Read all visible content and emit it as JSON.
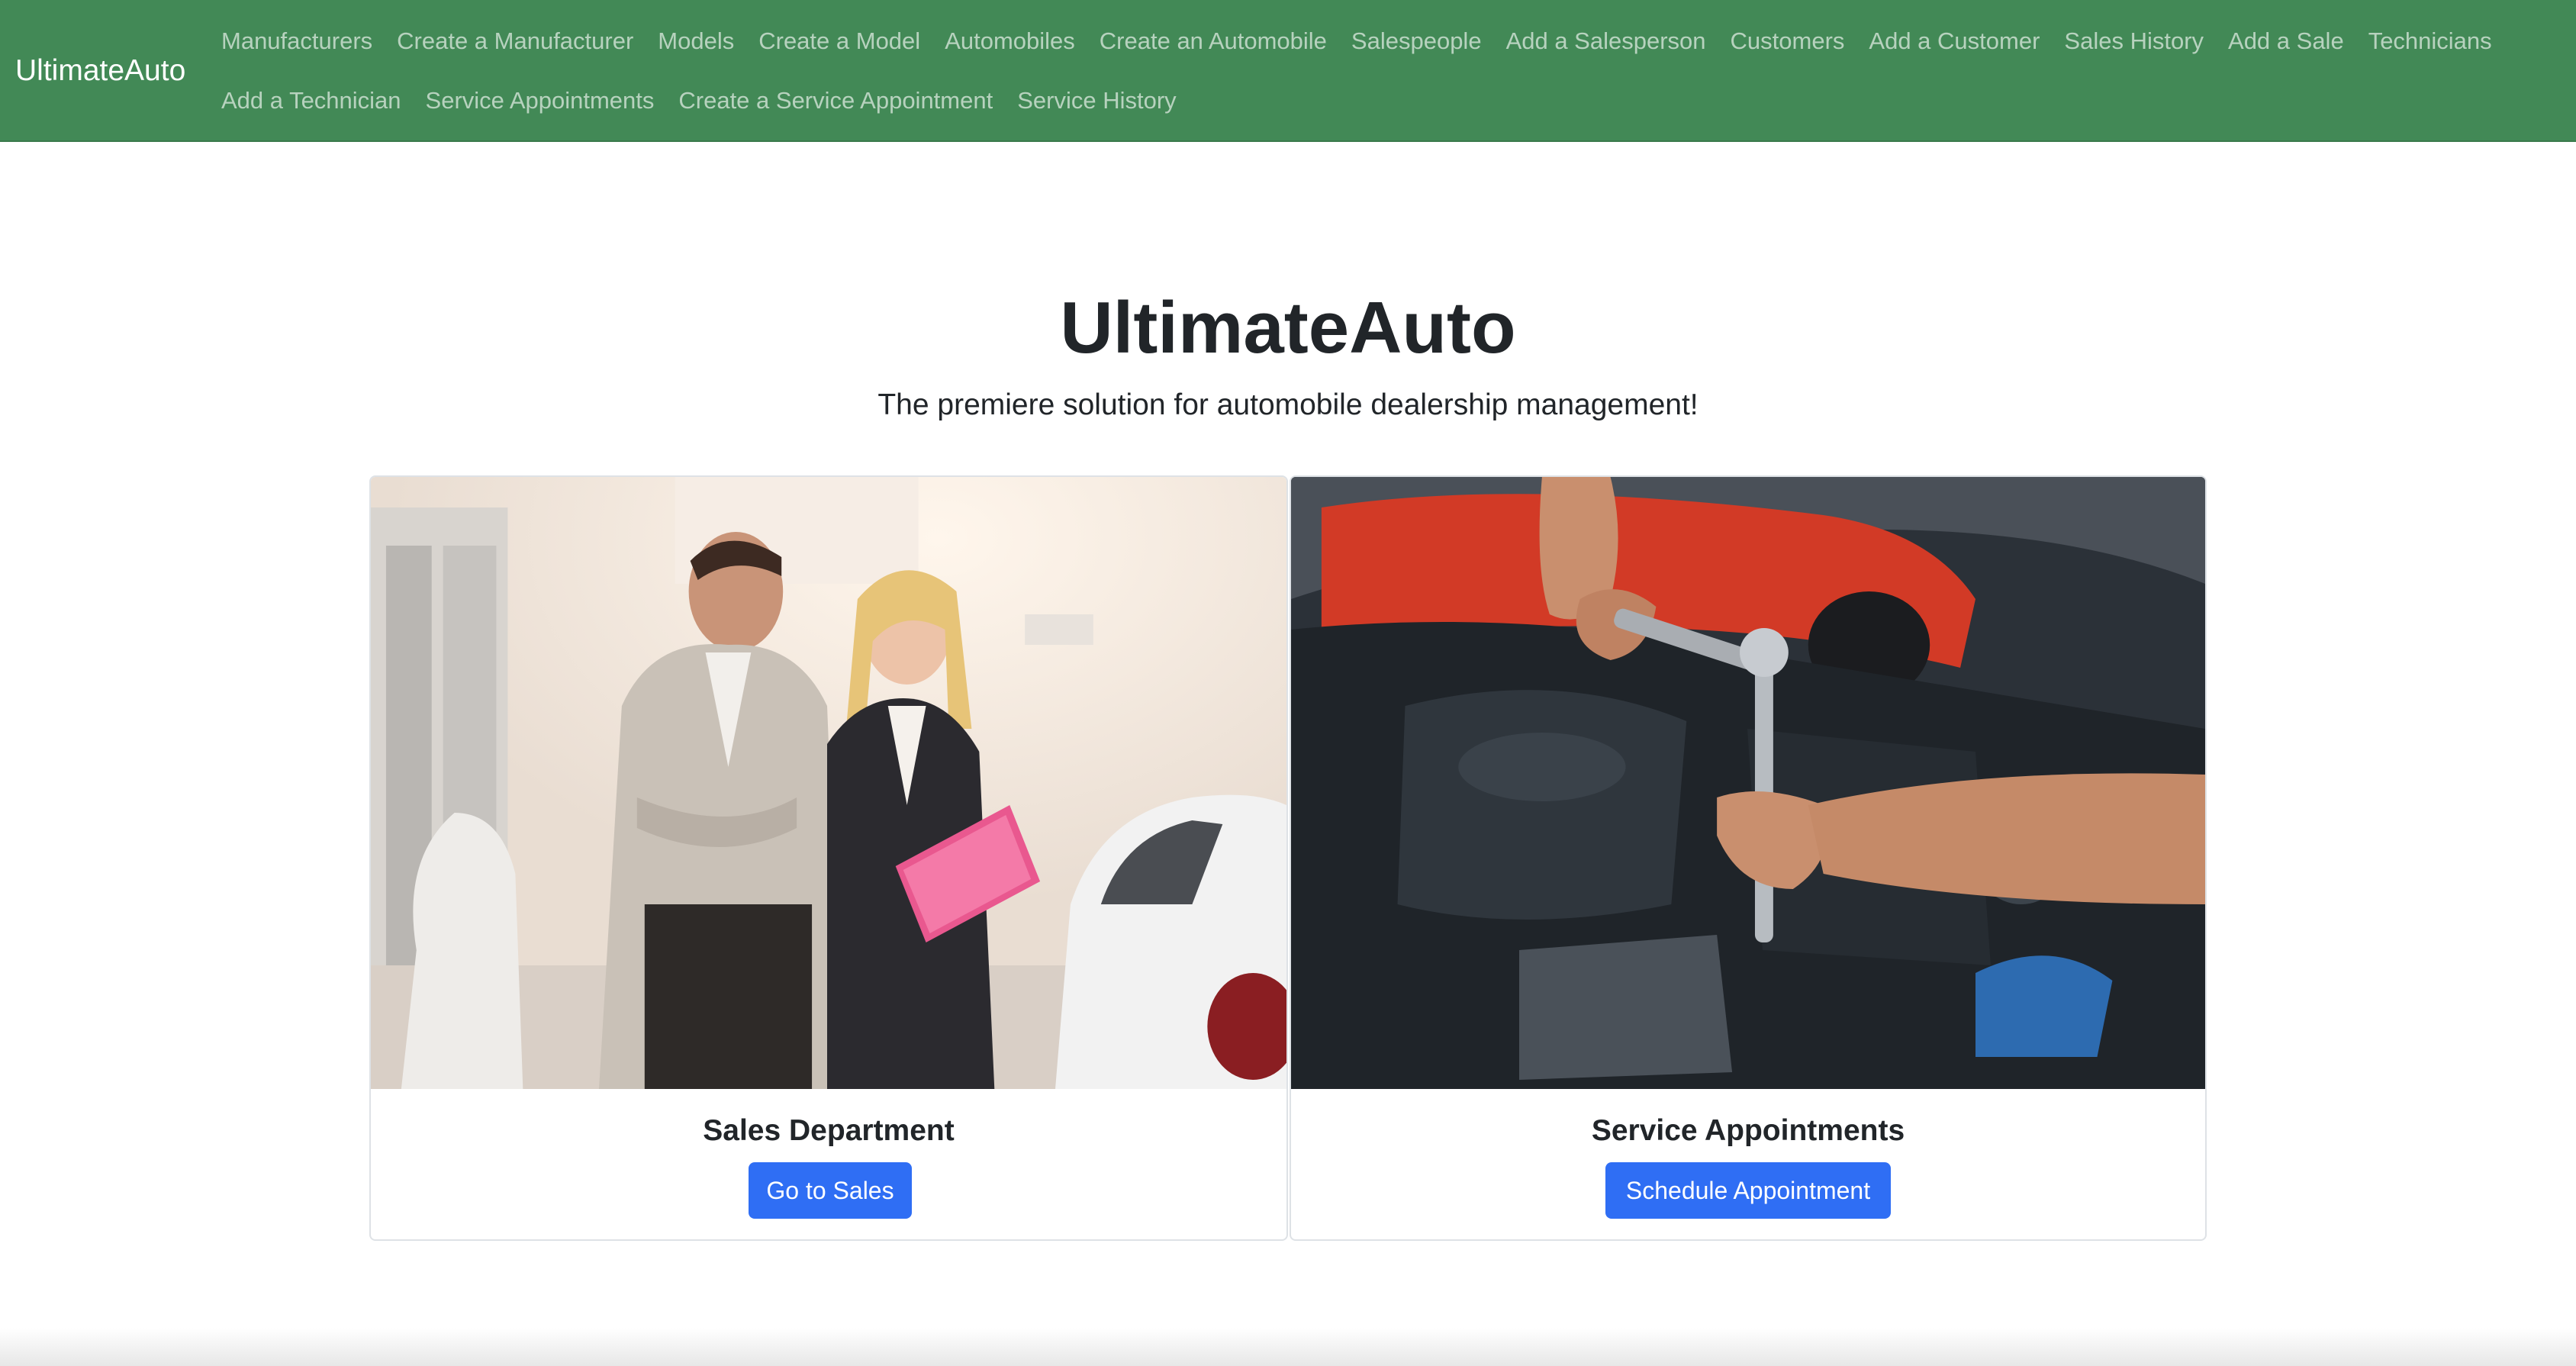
{
  "navbar": {
    "brand": "UltimateAuto",
    "row1": [
      {
        "label": "Manufacturers"
      },
      {
        "label": "Create a Manufacturer"
      },
      {
        "label": "Models"
      },
      {
        "label": "Create a Model"
      },
      {
        "label": "Automobiles"
      },
      {
        "label": "Create an Automobile"
      },
      {
        "label": "Salespeople"
      },
      {
        "label": "Add a Salesperson"
      },
      {
        "label": "Customers"
      },
      {
        "label": "Add a Customer"
      },
      {
        "label": "Sales History"
      },
      {
        "label": "Add a Sale"
      },
      {
        "label": "Technicians"
      }
    ],
    "row2": [
      {
        "label": "Add a Technician"
      },
      {
        "label": "Service Appointments"
      },
      {
        "label": "Create a Service Appointment"
      },
      {
        "label": "Service History"
      }
    ]
  },
  "hero": {
    "title": "UltimateAuto",
    "subtitle": "The premiere solution for automobile dealership management!"
  },
  "cards": [
    {
      "title": "Sales Department",
      "button": "Go to Sales",
      "image": "salespeople-with-clipboard-photo"
    },
    {
      "title": "Service Appointments",
      "button": "Schedule Appointment",
      "image": "mechanic-engine-wrench-photo"
    }
  ],
  "colors": {
    "navbar_bg": "#428956",
    "button_bg": "#2f6ef4"
  }
}
